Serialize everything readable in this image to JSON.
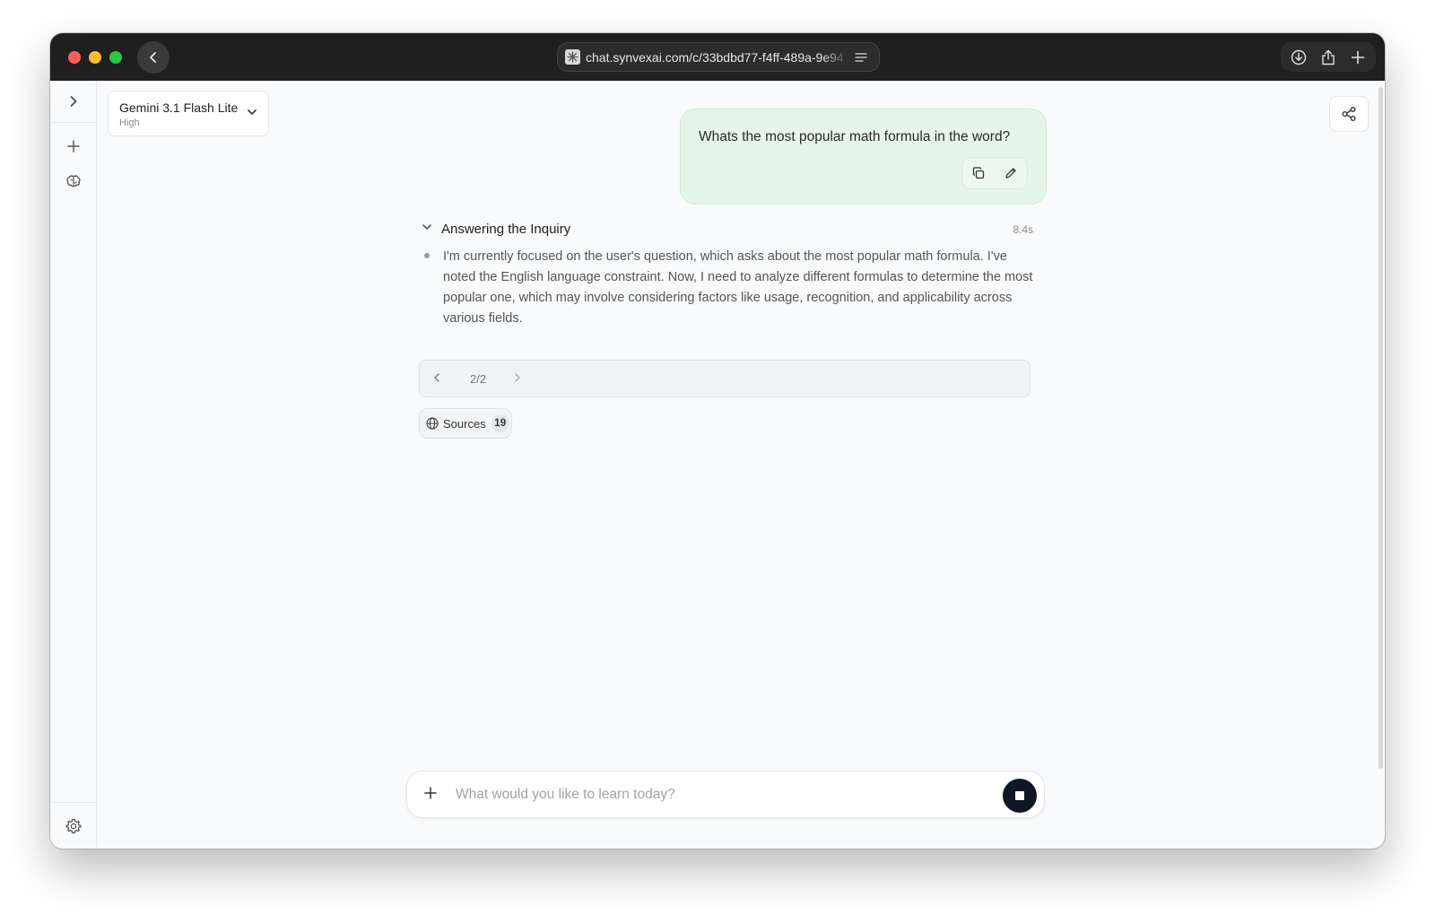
{
  "browser": {
    "url": "chat.synvexai.com/c/33bdbd77-f4ff-489a-9e94"
  },
  "model": {
    "name": "Gemini 3.1 Flash Lite",
    "effort": "High"
  },
  "conversation": {
    "user_message": "Whats the most popular math formula in the word?",
    "thinking": {
      "title": "Answering the Inquiry",
      "time": "8.4s",
      "text": "I'm currently focused on the user's question, which asks about the most popular math formula. I've noted the English language constraint. Now, I need to analyze different formulas to determine the most popular one, which may involve considering factors like usage, recognition, and applicability across various fields."
    },
    "pager": {
      "count": "2/2"
    },
    "sources": {
      "label": "Sources",
      "count": "19"
    }
  },
  "composer": {
    "placeholder": "What would you like to learn today?"
  },
  "icons": {
    "back": "chevron-left-icon",
    "favicon": "site-favicon-icon",
    "reader": "reader-mode-icon",
    "download": "download-icon",
    "share": "share-icon",
    "new_tab": "plus-icon",
    "sidebar_toggle": "chevron-right-icon",
    "new_chat": "plus-icon",
    "brain": "brain-icon",
    "settings": "gear-icon",
    "copy": "copy-icon",
    "edit": "pencil-icon",
    "globe": "globe-icon",
    "stop": "stop-icon"
  },
  "colors": {
    "titlebar": "#1f1f1f",
    "user_bubble": "#e6f5ea",
    "stop_button": "#0f1626",
    "traffic_red": "#ff5f57",
    "traffic_yellow": "#febc2e",
    "traffic_green": "#28c840"
  }
}
